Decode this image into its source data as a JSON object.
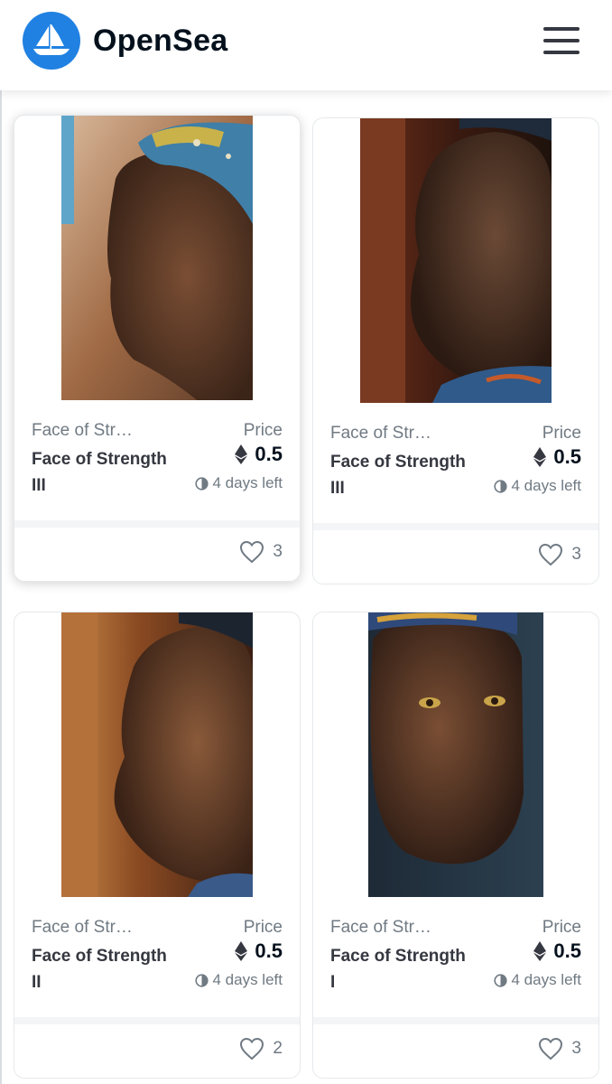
{
  "header": {
    "brand": "OpenSea",
    "logo_icon": "boat-logo-icon",
    "menu_icon": "hamburger-menu-icon",
    "accent": "#2081e2"
  },
  "cards": [
    {
      "collection": "Face of Str…",
      "name": "Face of Strength III",
      "price_label": "Price",
      "price": "0.5",
      "currency_icon": "eth-icon",
      "time_left": "4 days left",
      "likes": "3"
    },
    {
      "collection": "Face of Str…",
      "name": "Face of Strength III",
      "price_label": "Price",
      "price": "0.5",
      "currency_icon": "eth-icon",
      "time_left": "4 days left",
      "likes": "3"
    },
    {
      "collection": "Face of Str…",
      "name": "Face of Strength II",
      "price_label": "Price",
      "price": "0.5",
      "currency_icon": "eth-icon",
      "time_left": "4 days left",
      "likes": "2"
    },
    {
      "collection": "Face of Str…",
      "name": "Face of Strength I",
      "price_label": "Price",
      "price": "0.5",
      "currency_icon": "eth-icon",
      "time_left": "4 days left",
      "likes": "3"
    }
  ]
}
